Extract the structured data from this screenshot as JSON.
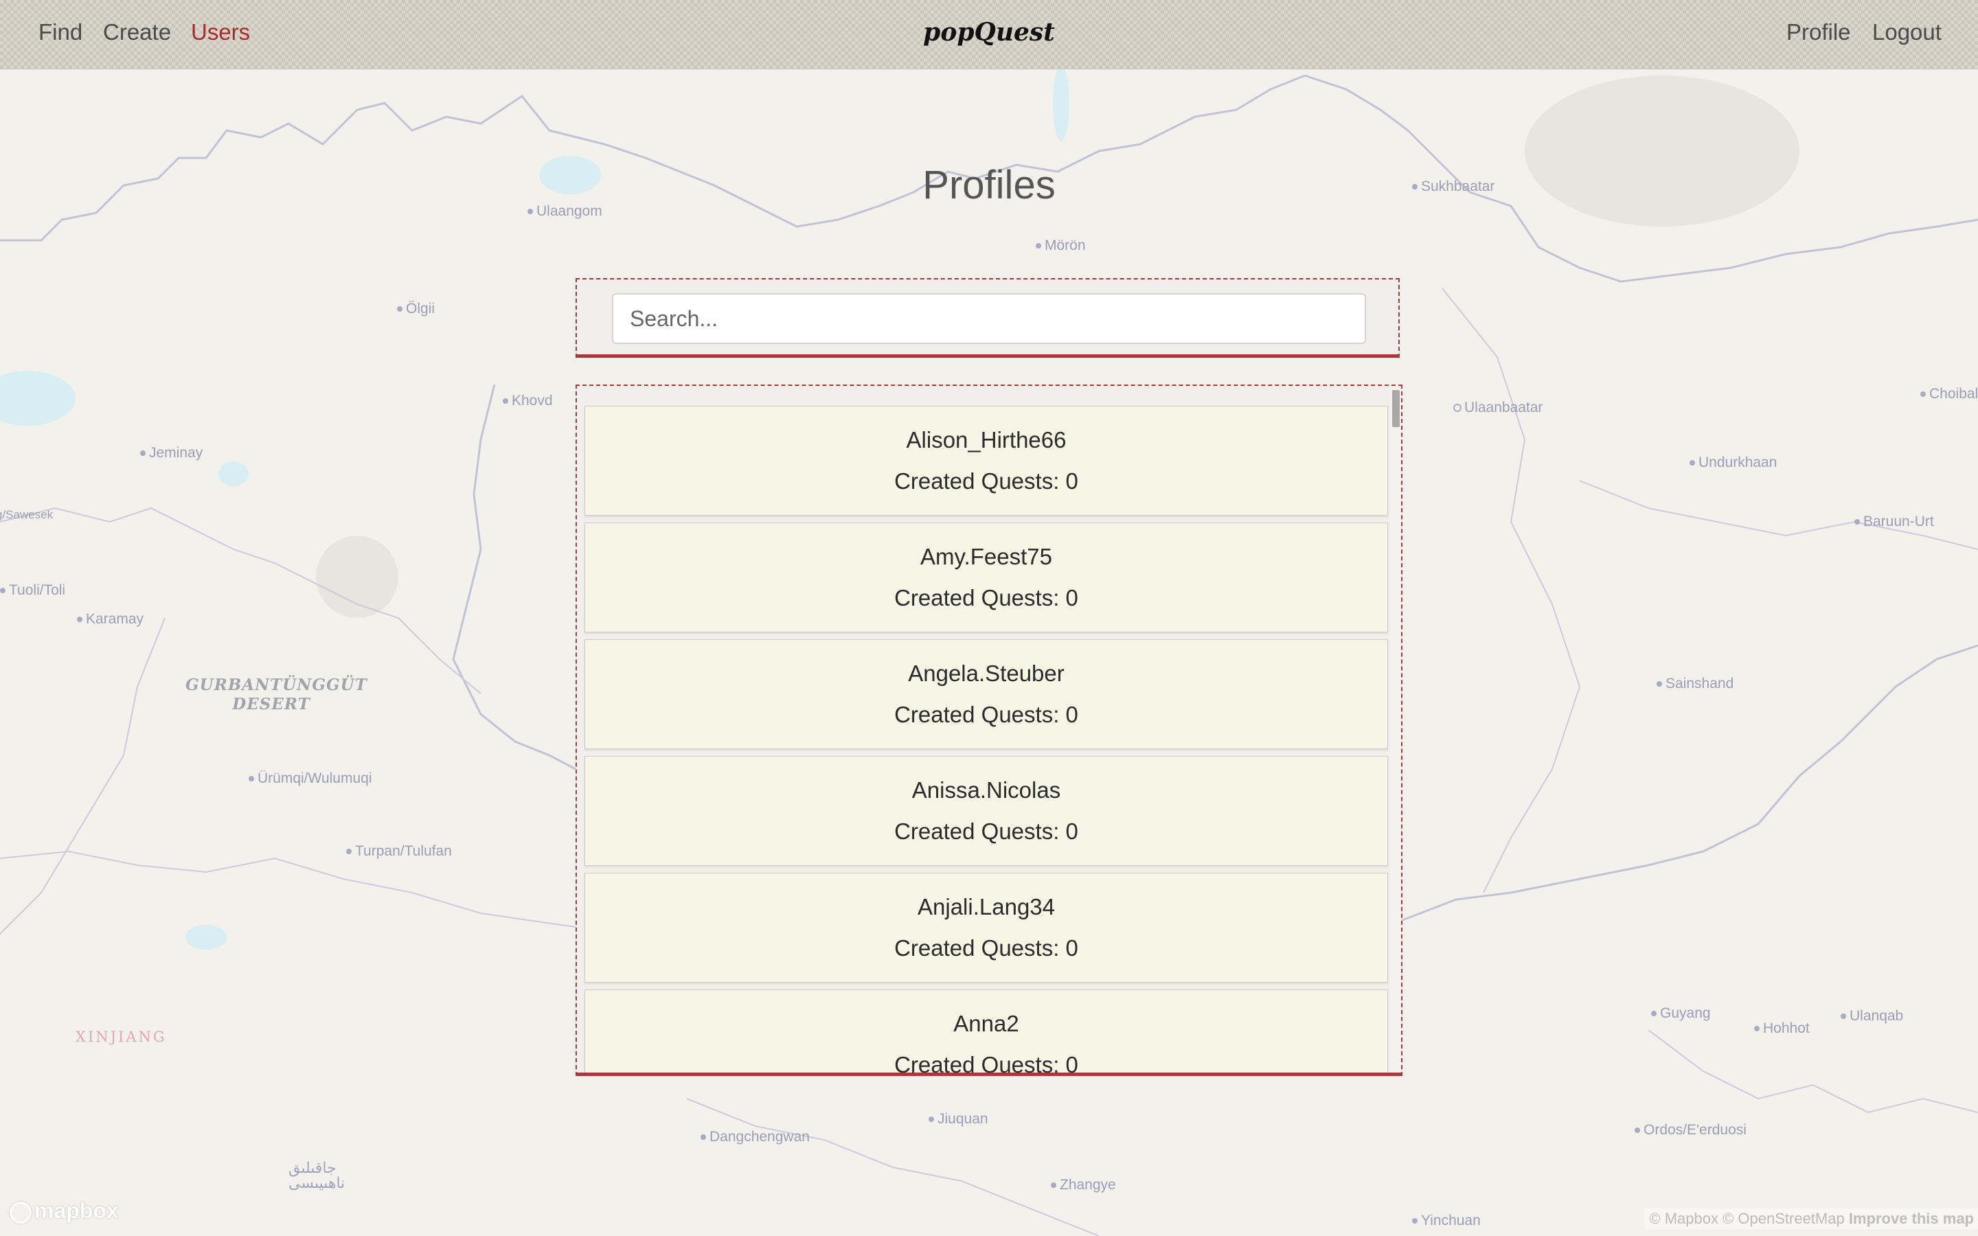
{
  "nav": {
    "links": [
      {
        "label": "Find",
        "active": false
      },
      {
        "label": "Create",
        "active": false
      },
      {
        "label": "Users",
        "active": true
      }
    ],
    "brand": "popQuest",
    "right_links": [
      {
        "label": "Profile"
      },
      {
        "label": "Logout"
      }
    ]
  },
  "page": {
    "title": "Profiles",
    "search_placeholder": "Search..."
  },
  "profiles": [
    {
      "username": "Alison_Hirthe66",
      "quests_text": "Created Quests: 0"
    },
    {
      "username": "Amy.Feest75",
      "quests_text": "Created Quests: 0"
    },
    {
      "username": "Angela.Steuber",
      "quests_text": "Created Quests: 0"
    },
    {
      "username": "Anissa.Nicolas",
      "quests_text": "Created Quests: 0"
    },
    {
      "username": "Anjali.Lang34",
      "quests_text": "Created Quests: 0"
    },
    {
      "username": "Anna2",
      "quests_text": "Created Quests: 0"
    }
  ],
  "map": {
    "places": [
      "Ulaangom",
      "Mörön",
      "Sukhbaatar",
      "Ölgii",
      "Khovd",
      "Ulaanbaatar",
      "Choibal",
      "Jeminay",
      "Undurkhaan",
      "Baruun-Urt",
      "g/Sawesek",
      "Tuoli/Toli",
      "Karamay",
      "Sainshand",
      "Ürümqi/Wulumuqi",
      "Turpan/Tulufan",
      "Guyang",
      "Hohhot",
      "Ulanqab",
      "Jiuquan",
      "Dangchengwan",
      "Ordos/E'erduosi",
      "Zhangye",
      "Yinchuan"
    ],
    "regions": [
      "GURBANTÜNGGÜT DESERT",
      "XINJIANG"
    ],
    "script_label": "جاقىلىق\nناھىيىسى",
    "logo": "mapbox",
    "attribution": "© Mapbox © OpenStreetMap",
    "improve_link": "Improve this map"
  },
  "colors": {
    "accent": "#a52c2c",
    "card_bg": "#f7f5e6",
    "panel_border": "#a33b3b"
  }
}
